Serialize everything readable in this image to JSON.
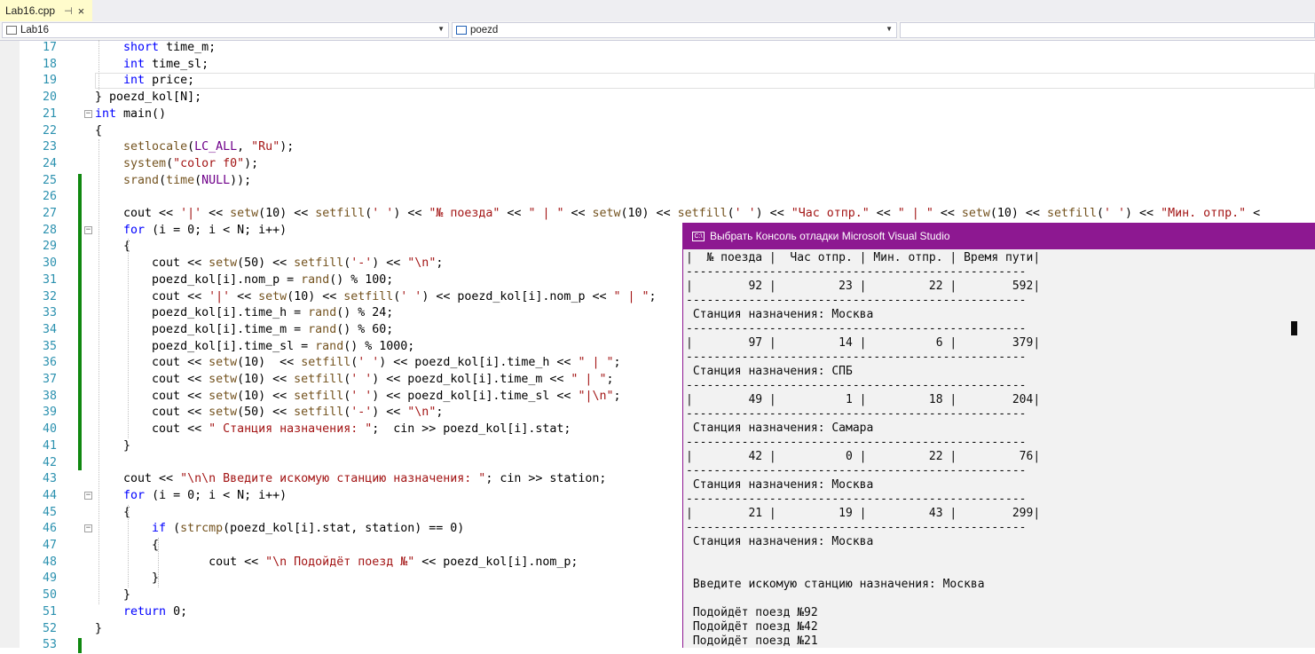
{
  "tab": {
    "title": "Lab16.cpp",
    "pin": "⊣",
    "close": "×"
  },
  "nav": {
    "project": "Lab16",
    "scope": "poezd",
    "member": ""
  },
  "code_lines": [
    {
      "n": "17",
      "html": "    <span class=\"kw\">short</span> time_m;"
    },
    {
      "n": "18",
      "html": "    <span class=\"kw\">int</span> time_sl;"
    },
    {
      "n": "19",
      "html": "    <span class=\"kw\">int</span> price;"
    },
    {
      "n": "20",
      "html": "} poezd_kol[N];"
    },
    {
      "n": "21",
      "html": "<span class=\"kw\">int</span> main()"
    },
    {
      "n": "22",
      "html": "{"
    },
    {
      "n": "23",
      "html": "    <span class=\"fn\">setlocale</span>(<span class=\"mac\">LC_ALL</span>, <span class=\"str\">\"Ru\"</span>);"
    },
    {
      "n": "24",
      "html": "    <span class=\"fn\">system</span>(<span class=\"str\">\"color f0\"</span>);"
    },
    {
      "n": "25",
      "html": "    <span class=\"fn\">srand</span>(<span class=\"fn\">time</span>(<span class=\"mac\">NULL</span>));"
    },
    {
      "n": "26",
      "html": ""
    },
    {
      "n": "27",
      "html": "    cout &lt;&lt; <span class=\"str\">'|'</span> &lt;&lt; <span class=\"fn\">setw</span>(10) &lt;&lt; <span class=\"fn\">setfill</span>(<span class=\"str\">' '</span>) &lt;&lt; <span class=\"str\">\"№ поезда\"</span> &lt;&lt; <span class=\"str\">\" | \"</span> &lt;&lt; <span class=\"fn\">setw</span>(10) &lt;&lt; <span class=\"fn\">setfill</span>(<span class=\"str\">' '</span>) &lt;&lt; <span class=\"str\">\"Час отпр.\"</span> &lt;&lt; <span class=\"str\">\" | \"</span> &lt;&lt; <span class=\"fn\">setw</span>(10) &lt;&lt; <span class=\"fn\">setfill</span>(<span class=\"str\">' '</span>) &lt;&lt; <span class=\"str\">\"Мин. отпр.\"</span> &lt;"
    },
    {
      "n": "28",
      "html": "    <span class=\"kw\">for</span> (i = 0; i &lt; N; i++)"
    },
    {
      "n": "29",
      "html": "    {"
    },
    {
      "n": "30",
      "html": "        cout &lt;&lt; <span class=\"fn\">setw</span>(50) &lt;&lt; <span class=\"fn\">setfill</span>(<span class=\"str\">'-'</span>) &lt;&lt; <span class=\"str\">\"\\n\"</span>;"
    },
    {
      "n": "31",
      "html": "        poezd_kol[i].nom_p = <span class=\"fn\">rand</span>() % 100;"
    },
    {
      "n": "32",
      "html": "        cout &lt;&lt; <span class=\"str\">'|'</span> &lt;&lt; <span class=\"fn\">setw</span>(10) &lt;&lt; <span class=\"fn\">setfill</span>(<span class=\"str\">' '</span>) &lt;&lt; poezd_kol[i].nom_p &lt;&lt; <span class=\"str\">\" | \"</span>;"
    },
    {
      "n": "33",
      "html": "        poezd_kol[i].time_h = <span class=\"fn\">rand</span>() % 24;"
    },
    {
      "n": "34",
      "html": "        poezd_kol[i].time_m = <span class=\"fn\">rand</span>() % 60;"
    },
    {
      "n": "35",
      "html": "        poezd_kol[i].time_sl = <span class=\"fn\">rand</span>() % 1000;"
    },
    {
      "n": "36",
      "html": "        cout &lt;&lt; <span class=\"fn\">setw</span>(10)  &lt;&lt; <span class=\"fn\">setfill</span>(<span class=\"str\">' '</span>) &lt;&lt; poezd_kol[i].time_h &lt;&lt; <span class=\"str\">\" | \"</span>;"
    },
    {
      "n": "37",
      "html": "        cout &lt;&lt; <span class=\"fn\">setw</span>(10) &lt;&lt; <span class=\"fn\">setfill</span>(<span class=\"str\">' '</span>) &lt;&lt; poezd_kol[i].time_m &lt;&lt; <span class=\"str\">\" | \"</span>;"
    },
    {
      "n": "38",
      "html": "        cout &lt;&lt; <span class=\"fn\">setw</span>(10) &lt;&lt; <span class=\"fn\">setfill</span>(<span class=\"str\">' '</span>) &lt;&lt; poezd_kol[i].time_sl &lt;&lt; <span class=\"str\">\"|\\n\"</span>;"
    },
    {
      "n": "39",
      "html": "        cout &lt;&lt; <span class=\"fn\">setw</span>(50) &lt;&lt; <span class=\"fn\">setfill</span>(<span class=\"str\">'-'</span>) &lt;&lt; <span class=\"str\">\"\\n\"</span>;"
    },
    {
      "n": "40",
      "html": "        cout &lt;&lt; <span class=\"str\">\" Станция назначения: \"</span>;  cin &gt;&gt; poezd_kol[i].stat;"
    },
    {
      "n": "41",
      "html": "    }"
    },
    {
      "n": "42",
      "html": ""
    },
    {
      "n": "43",
      "html": "    cout &lt;&lt; <span class=\"str\">\"\\n\\n Введите искомую станцию назначения: \"</span>; cin &gt;&gt; station;"
    },
    {
      "n": "44",
      "html": "    <span class=\"kw\">for</span> (i = 0; i &lt; N; i++)"
    },
    {
      "n": "45",
      "html": "    {"
    },
    {
      "n": "46",
      "html": "        <span class=\"kw\">if</span> (<span class=\"fn\">strcmp</span>(poezd_kol[i].stat, station) == 0)"
    },
    {
      "n": "47",
      "html": "        {"
    },
    {
      "n": "48",
      "html": "                cout &lt;&lt; <span class=\"str\">\"\\n Подойдёт поезд №\"</span> &lt;&lt; poezd_kol[i].nom_p;"
    },
    {
      "n": "49",
      "html": "        }"
    },
    {
      "n": "50",
      "html": "    }"
    },
    {
      "n": "51",
      "html": "    <span class=\"kw\">return</span> 0;"
    },
    {
      "n": "52",
      "html": "}"
    },
    {
      "n": "53",
      "html": ""
    }
  ],
  "console": {
    "title": "Выбрать Консоль отладки Microsoft Visual Studio",
    "lines": [
      "|  № поезда |  Час отпр. | Мин. отпр. | Время пути|",
      "-------------------------------------------------",
      "|        92 |         23 |         22 |        592|",
      "-------------------------------------------------",
      " Станция назначения: Москва",
      "-------------------------------------------------",
      "|        97 |         14 |          6 |        379|",
      "-------------------------------------------------",
      " Станция назначения: СПБ",
      "-------------------------------------------------",
      "|        49 |          1 |         18 |        204|",
      "-------------------------------------------------",
      " Станция назначения: Самара",
      "-------------------------------------------------",
      "|        42 |          0 |         22 |         76|",
      "-------------------------------------------------",
      " Станция назначения: Москва",
      "-------------------------------------------------",
      "|        21 |         19 |         43 |        299|",
      "-------------------------------------------------",
      " Станция назначения: Москва",
      "",
      "",
      " Введите искомую станцию назначения: Москва",
      "",
      " Подойдёт поезд №92",
      " Подойдёт поезд №42",
      " Подойдёт поезд №21"
    ]
  }
}
